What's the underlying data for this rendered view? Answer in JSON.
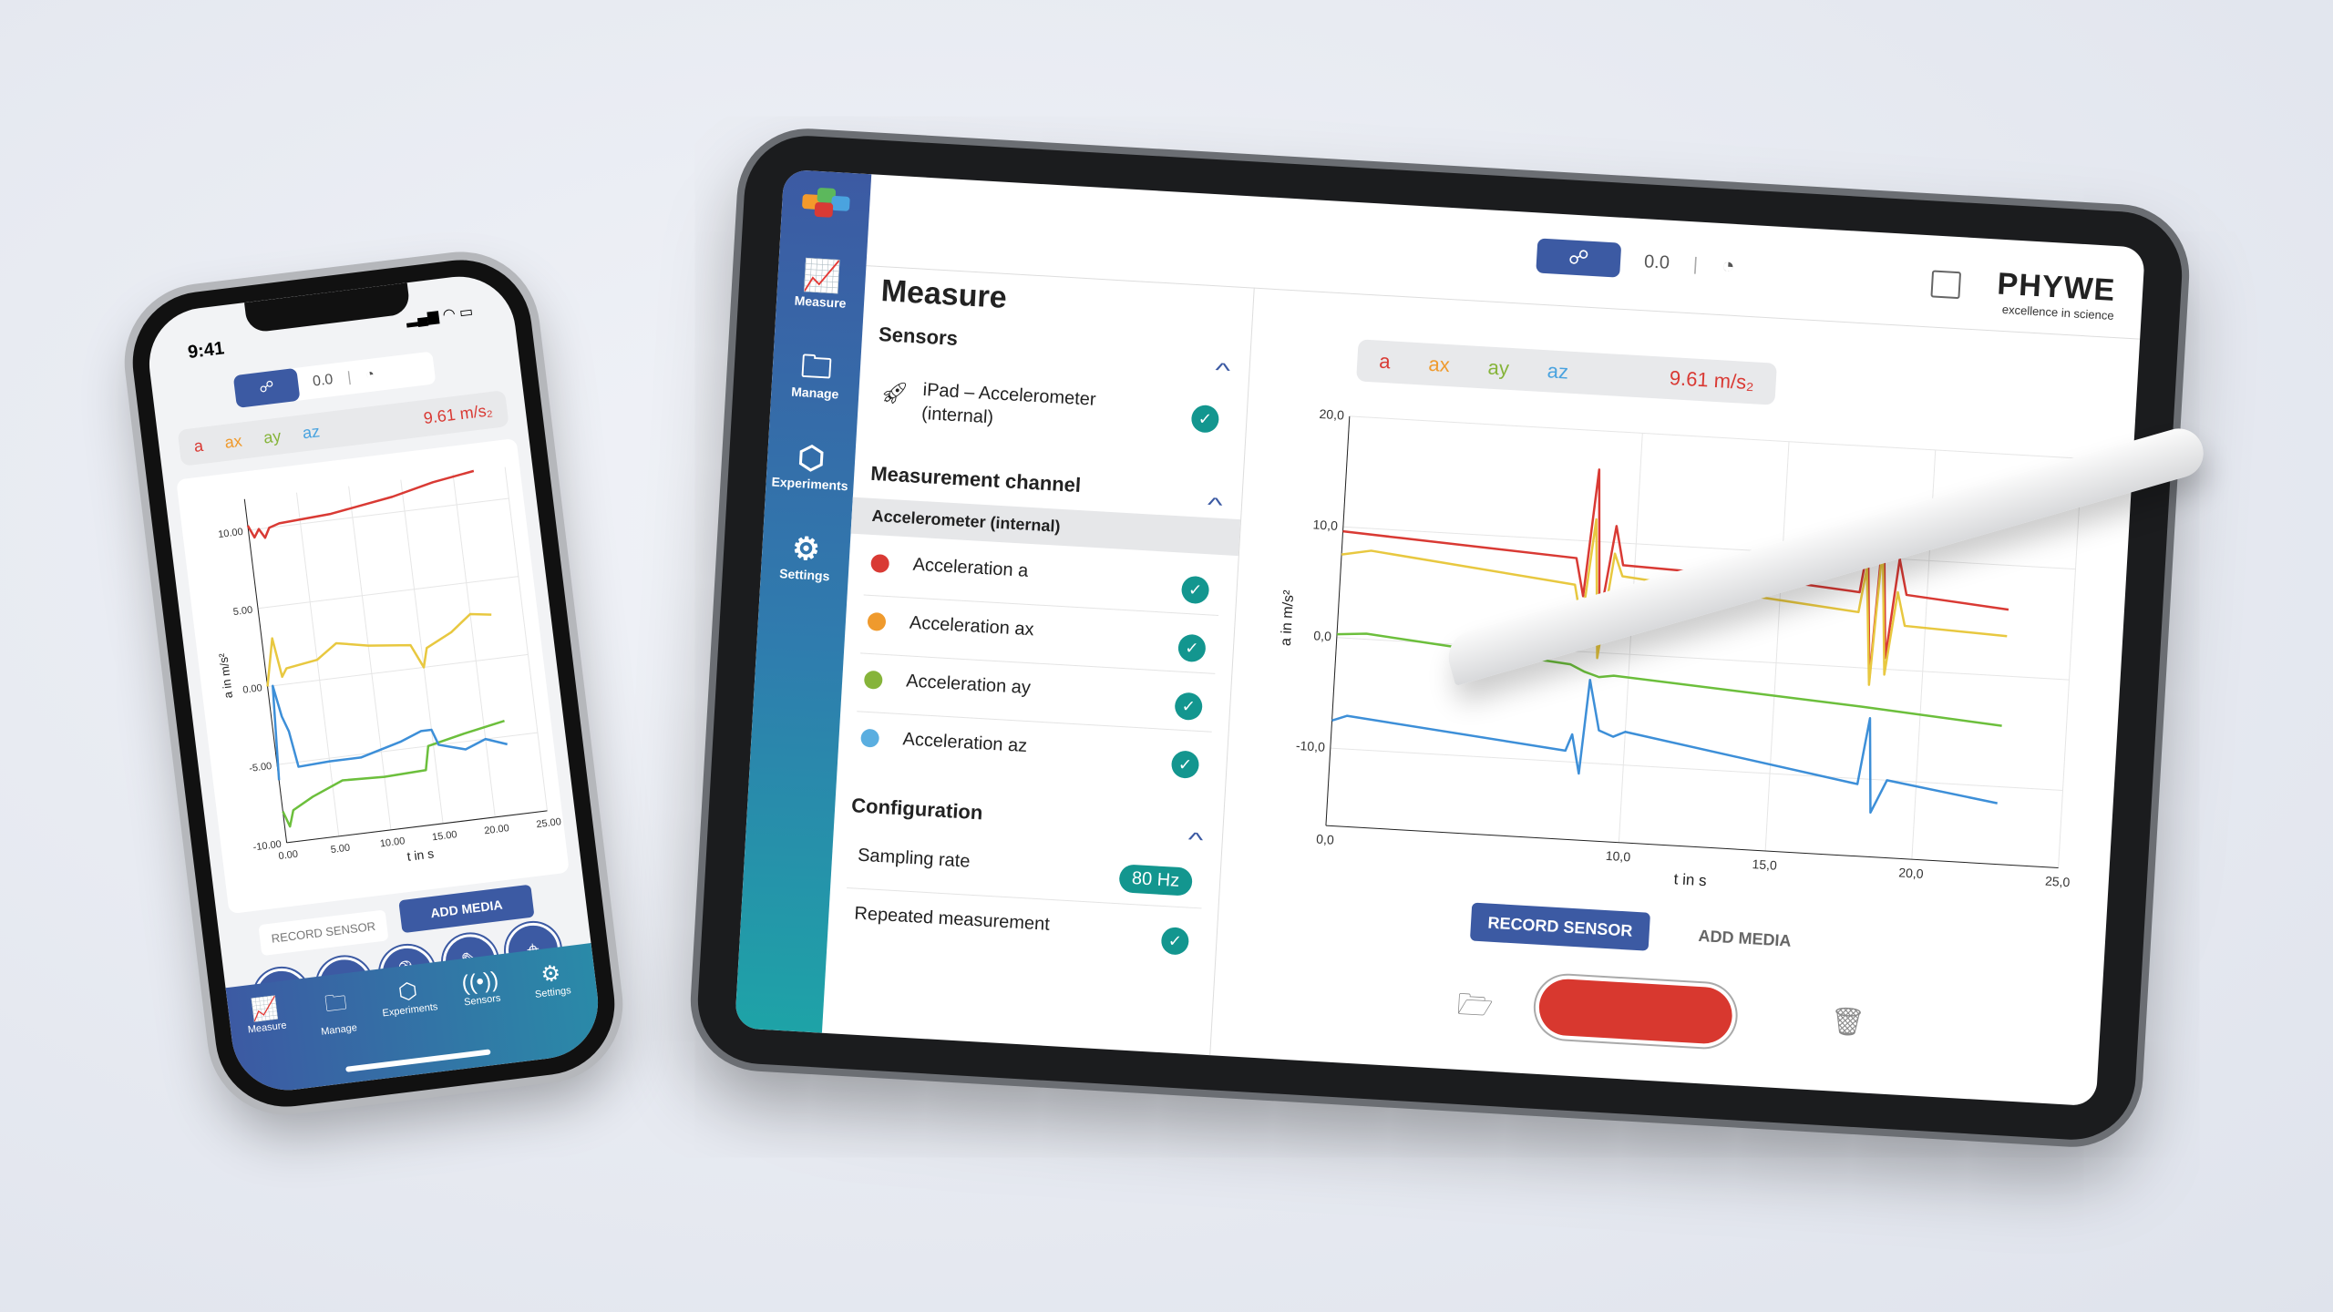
{
  "colors": {
    "a": "#d93a34",
    "ax": "#e8c840",
    "ay": "#6cbf3c",
    "az": "#3d8fd8",
    "brand_blue": "#3c5aa3",
    "teal": "#13968f",
    "record": "#d8382f"
  },
  "tablet": {
    "sidebar": [
      {
        "label": "Measure",
        "icon": "chart-icon"
      },
      {
        "label": "Manage",
        "icon": "folder-icon"
      },
      {
        "label": "Experiments",
        "icon": "cubes-icon"
      },
      {
        "label": "Settings",
        "icon": "gear-icon"
      }
    ],
    "title": "Measure",
    "sensors": {
      "heading": "Sensors",
      "item": "iPad – Accelerometer (internal)"
    },
    "channel": {
      "heading": "Measurement channel",
      "subheading": "Accelerometer (internal)",
      "items": [
        "Acceleration a",
        "Acceleration ax",
        "Acceleration ay",
        "Acceleration az"
      ]
    },
    "config": {
      "heading": "Configuration",
      "sampling_label": "Sampling rate",
      "sampling_value": "80 Hz",
      "repeated_label": "Repeated measurement"
    },
    "toolbar": {
      "value": "0.0"
    },
    "brand": {
      "name": "PHYWE",
      "tagline": "excellence in science"
    },
    "legend": {
      "a": "a",
      "ax": "ax",
      "ay": "ay",
      "az": "az",
      "reading": "9.61 m/s₂"
    },
    "record_sensor": "RECORD SENSOR",
    "add_media": "ADD MEDIA"
  },
  "phone": {
    "time": "9:41",
    "toolbar": {
      "value": "0.0"
    },
    "legend": {
      "a": "a",
      "ax": "ax",
      "ay": "ay",
      "az": "az",
      "reading": "9.61 m/s₂"
    },
    "record_sensor": "RECORD SENSOR",
    "add_media": "ADD MEDIA",
    "nav": [
      {
        "label": "Measure",
        "icon": "chart-icon"
      },
      {
        "label": "Manage",
        "icon": "folder-icon"
      },
      {
        "label": "Experiments",
        "icon": "cubes-icon"
      },
      {
        "label": "Sensors",
        "icon": "signal-icon"
      },
      {
        "label": "Settings",
        "icon": "gear-icon"
      }
    ]
  },
  "chart_data": [
    {
      "type": "line",
      "xlabel": "t in s",
      "ylabel": "a in m/s²",
      "xlim": [
        0,
        25
      ],
      "ylim": [
        -17,
        20
      ],
      "xticks": [
        "0,0",
        "10,0",
        "15,0",
        "20,0",
        "25,0"
      ],
      "xtick_values": [
        0,
        10,
        15,
        20,
        25
      ],
      "yticks": [
        "20,0",
        "10,0",
        "0,0",
        "-10,0"
      ],
      "ytick_values": [
        20,
        10,
        0,
        -10
      ],
      "grid": true,
      "series": [
        {
          "name": "a",
          "points": [
            [
              0,
              9.6
            ],
            [
              2,
              9.3
            ],
            [
              8,
              8.4
            ],
            [
              8.3,
              5
            ],
            [
              8.6,
              16.5
            ],
            [
              8.9,
              3
            ],
            [
              9.3,
              11.5
            ],
            [
              9.6,
              8
            ],
            [
              14,
              7.6
            ],
            [
              17.7,
              6.8
            ],
            [
              17.9,
              11
            ],
            [
              18.2,
              -1
            ],
            [
              18.4,
              13
            ],
            [
              18.7,
              1
            ],
            [
              19,
              10
            ],
            [
              19.3,
              6.8
            ],
            [
              22.8,
              6
            ]
          ]
        },
        {
          "name": "ax",
          "points": [
            [
              0,
              7.5
            ],
            [
              1,
              8
            ],
            [
              8,
              6
            ],
            [
              8.3,
              2.5
            ],
            [
              8.6,
              12
            ],
            [
              8.9,
              -0.5
            ],
            [
              9.3,
              9
            ],
            [
              9.6,
              7
            ],
            [
              17.7,
              5
            ],
            [
              17.9,
              9
            ],
            [
              18.2,
              -1.5
            ],
            [
              18.4,
              11
            ],
            [
              18.7,
              -0.5
            ],
            [
              19,
              7
            ],
            [
              19.3,
              4
            ],
            [
              22.8,
              3.6
            ]
          ]
        },
        {
          "name": "ay",
          "points": [
            [
              0,
              0.3
            ],
            [
              1,
              0.5
            ],
            [
              8,
              -1.2
            ],
            [
              8.5,
              -1.8
            ],
            [
              9,
              -2.2
            ],
            [
              9.5,
              -2
            ],
            [
              18,
              -3.5
            ],
            [
              22.8,
              -4.5
            ]
          ]
        },
        {
          "name": "az",
          "points": [
            [
              0,
              -7.5
            ],
            [
              0.5,
              -7
            ],
            [
              8,
              -9
            ],
            [
              8.2,
              -7.5
            ],
            [
              8.5,
              -11
            ],
            [
              8.7,
              -2.5
            ],
            [
              9.1,
              -7
            ],
            [
              9.6,
              -7.5
            ],
            [
              10,
              -7
            ],
            [
              18,
              -10.5
            ],
            [
              18.3,
              -4.5
            ],
            [
              18.5,
              -13
            ],
            [
              19,
              -10
            ],
            [
              22.8,
              -11.5
            ]
          ]
        }
      ]
    },
    {
      "type": "line",
      "xlabel": "t in s",
      "ylabel": "a in m/s²",
      "xlim": [
        0,
        25
      ],
      "ylim": [
        -10,
        12
      ],
      "xticks": [
        "0.00",
        "5.00",
        "10.00",
        "15.00",
        "20.00",
        "25.00"
      ],
      "xtick_values": [
        0,
        5,
        10,
        15,
        20,
        25
      ],
      "yticks": [
        "10.00",
        "5.00",
        "0.00",
        "-5.00",
        "-10.00"
      ],
      "ytick_values": [
        10,
        5,
        0,
        -5,
        -10
      ],
      "grid": true,
      "series": [
        {
          "name": "a",
          "points": [
            [
              0,
              10.3
            ],
            [
              0.5,
              9.5
            ],
            [
              1,
              10
            ],
            [
              1.5,
              9.4
            ],
            [
              2,
              10
            ],
            [
              3,
              10.2
            ],
            [
              8,
              10.4
            ],
            [
              14,
              11
            ],
            [
              18,
              11.6
            ],
            [
              22,
              12
            ]
          ]
        },
        {
          "name": "ax",
          "points": [
            [
              0,
              0
            ],
            [
              0.5,
              1.5
            ],
            [
              1,
              3
            ],
            [
              1.5,
              0.5
            ],
            [
              2,
              1
            ],
            [
              5,
              1.3
            ],
            [
              7,
              2.2
            ],
            [
              10,
              1.8
            ],
            [
              14,
              1.5
            ],
            [
              15,
              0
            ],
            [
              15.5,
              1.2
            ],
            [
              18,
              2
            ],
            [
              20,
              3
            ],
            [
              22,
              2.8
            ]
          ]
        },
        {
          "name": "ay",
          "points": [
            [
              0,
              -8
            ],
            [
              0.5,
              -9
            ],
            [
              1,
              -8
            ],
            [
              3,
              -7.3
            ],
            [
              6,
              -6.5
            ],
            [
              10,
              -6.6
            ],
            [
              14,
              -6.5
            ],
            [
              14.5,
              -5
            ],
            [
              18,
              -4.5
            ],
            [
              22,
              -4
            ]
          ]
        },
        {
          "name": "az",
          "points": [
            [
              0,
              -6
            ],
            [
              0.5,
              0
            ],
            [
              1,
              -2
            ],
            [
              1.5,
              -3
            ],
            [
              2,
              -5.3
            ],
            [
              5,
              -5.2
            ],
            [
              8,
              -5.2
            ],
            [
              12,
              -4.5
            ],
            [
              14,
              -4
            ],
            [
              15,
              -4
            ],
            [
              15.5,
              -5
            ],
            [
              18,
              -5.5
            ],
            [
              20,
              -5
            ],
            [
              22,
              -5.5
            ]
          ]
        }
      ]
    }
  ]
}
